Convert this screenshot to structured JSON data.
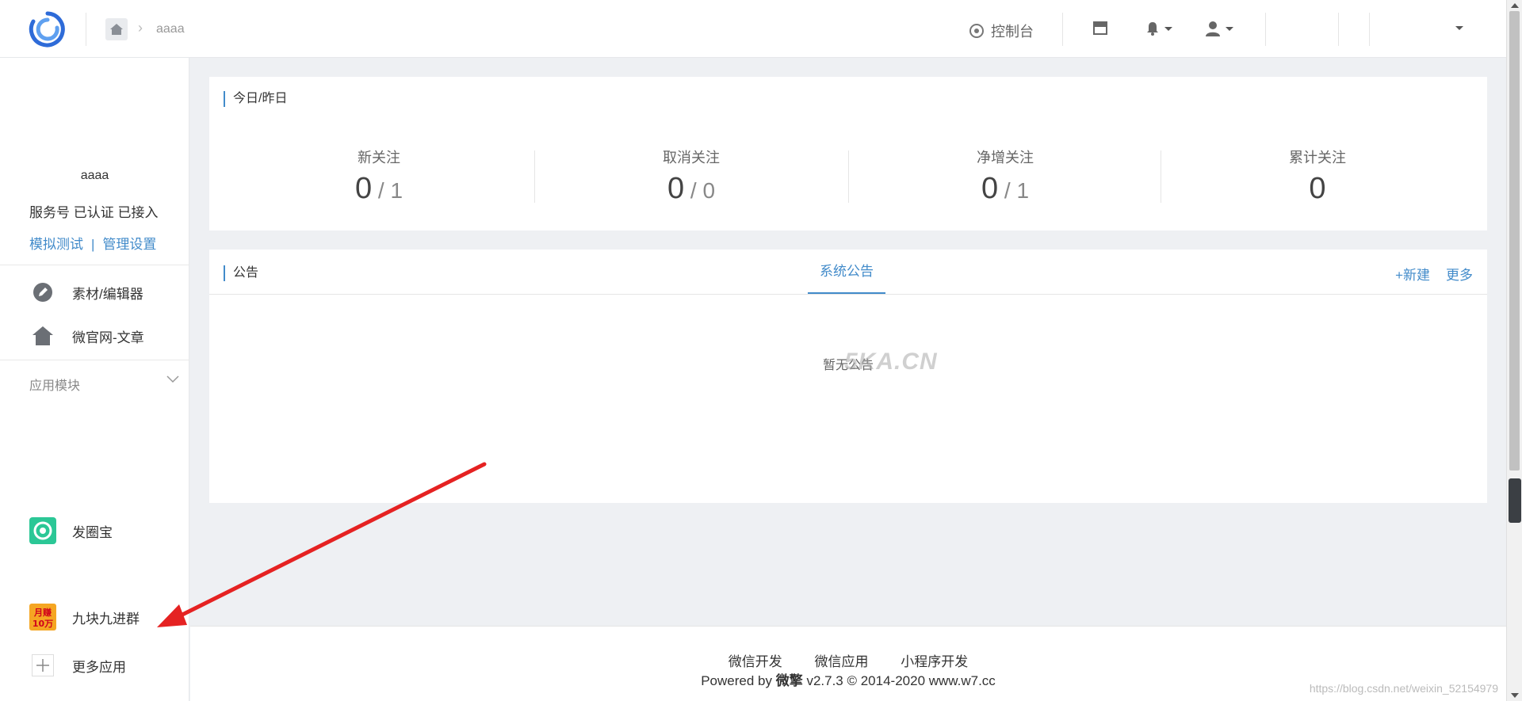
{
  "topbar": {
    "breadcrumb": "aaaa",
    "console_label": "控制台"
  },
  "account": {
    "name": "aaaa",
    "type": "服务号 已认证 已接入",
    "link_test": "模拟测试",
    "link_divider": "|",
    "link_settings": "管理设置"
  },
  "sidebar": {
    "items": [
      {
        "label": "素材/编辑器",
        "icon": "pencil-icon"
      },
      {
        "label": "微官网-文章",
        "icon": "home-icon"
      }
    ],
    "section_label": "应用模块",
    "apps": [
      {
        "label": "发圈宝",
        "icon": "camera-aperture-icon"
      },
      {
        "label": "九块九进群",
        "icon": "money-badge-icon",
        "badge_text": "月赚10万"
      },
      {
        "label": "更多应用",
        "icon": "plus-icon"
      }
    ]
  },
  "stats_card": {
    "title": "今日/昨日",
    "stats": [
      {
        "label": "新关注",
        "today": "0",
        "slash": "/",
        "yesterday": "1"
      },
      {
        "label": "取消关注",
        "today": "0",
        "slash": "/",
        "yesterday": "0"
      },
      {
        "label": "净增关注",
        "today": "0",
        "slash": "/",
        "yesterday": "1"
      },
      {
        "label": "累计关注",
        "today": "0"
      }
    ]
  },
  "notice_card": {
    "title": "公告",
    "tab": "系统公告",
    "new_label": "+新建",
    "more_label": "更多",
    "empty_text": "暂无公告"
  },
  "watermark": "5KA.CN",
  "footer": {
    "links": [
      "微信开发",
      "微信应用",
      "小程序开发"
    ],
    "powered_prefix": "Powered by",
    "powered_brand": "微擎",
    "powered_suffix": "v2.7.3 © 2014-2020 www.w7.cc",
    "csdn": "https://blog.csdn.net/weixin_52154979"
  },
  "colors": {
    "accent": "#428bca",
    "annotation_arrow": "#e52222"
  }
}
